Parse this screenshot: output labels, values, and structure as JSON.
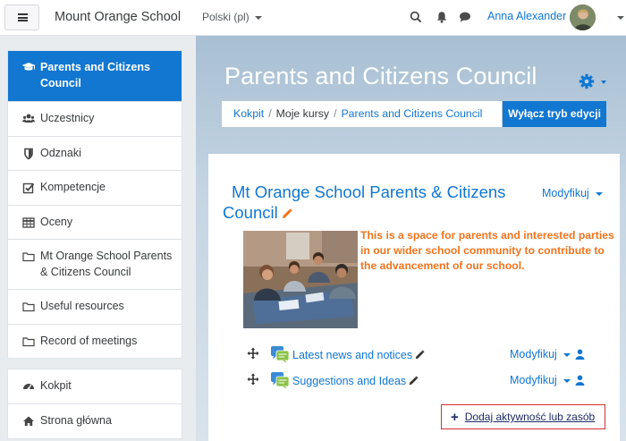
{
  "navbar": {
    "brand": "Mount Orange School",
    "language": "Polski (pl)",
    "user_name": "Anna Alexander",
    "icons": [
      "menu-icon",
      "search-icon",
      "bell-icon",
      "message-icon"
    ]
  },
  "sidebar": {
    "course_items": [
      {
        "label": "Parents and Citizens Council",
        "icon": "graduation-cap-icon",
        "active": true
      },
      {
        "label": "Uczestnicy",
        "icon": "users-icon"
      },
      {
        "label": "Odznaki",
        "icon": "shield-icon"
      },
      {
        "label": "Kompetencje",
        "icon": "checkbox-icon"
      },
      {
        "label": "Oceny",
        "icon": "table-icon"
      },
      {
        "label": "Mt Orange School Parents & Citizens Council",
        "icon": "folder-icon"
      },
      {
        "label": "Useful resources",
        "icon": "folder-icon"
      },
      {
        "label": "Record of meetings",
        "icon": "folder-icon"
      }
    ],
    "site_items": [
      {
        "label": "Kokpit",
        "icon": "dashboard-icon"
      },
      {
        "label": "Strona główna",
        "icon": "home-icon"
      }
    ]
  },
  "header": {
    "page_title": "Parents and Citizens Council",
    "breadcrumb": [
      "Kokpit",
      "Moje kursy",
      "Parents and Citizens Council"
    ],
    "edit_button": "Wyłącz tryb edycji"
  },
  "section": {
    "title_line1": "Mt Orange School Parents & Citizens",
    "title_line2": "Council",
    "modify_label": "Modyfikuj",
    "summary": "This is a space for parents and interested parties in our wider school community to contribute to the advancement of our school.",
    "activities": [
      {
        "name": "Latest news and notices",
        "modify_label": "Modyfikuj"
      },
      {
        "name": "Suggestions and Ideas",
        "modify_label": "Modyfikuj"
      }
    ],
    "add_activity": "Dodaj aktywność lub zasób"
  },
  "colors": {
    "accent": "#1177d1",
    "summary_text": "#f0741e",
    "highlight_border": "#d32f2f"
  }
}
